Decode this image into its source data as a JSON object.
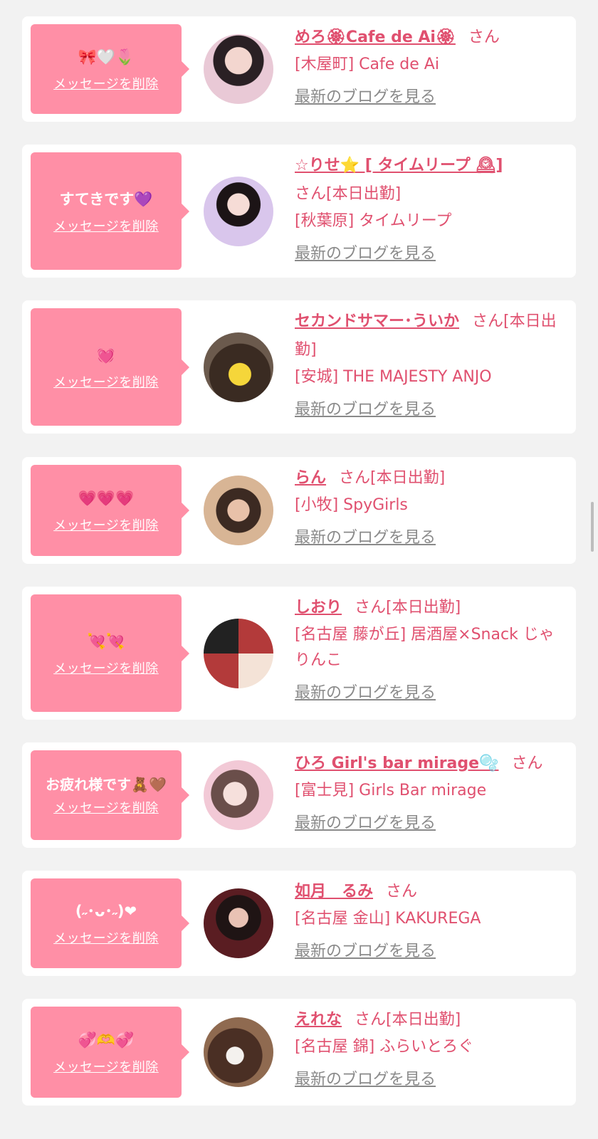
{
  "delete_label": "メッセージを削除",
  "blog_label": "最新のブログを見る",
  "colors": {
    "accent": "#ff8fa6",
    "name": "#e0506f",
    "link_gray": "#8a8a8a",
    "bg": "#f2f2f2"
  },
  "items": [
    {
      "message": "🎀🤍🌷",
      "name": "めろ🏵Cafe de Ai🏵",
      "suffix": "さん",
      "shop": "[木屋町] Cafe de Ai"
    },
    {
      "message": "すてきです💜",
      "name": "☆りせ⭐ [ タイムリープ 🕰]",
      "suffix": "さん[本日出勤]",
      "shop": "[秋葉原] タイムリープ"
    },
    {
      "message": "💓",
      "name": "セカンドサマー･ういか",
      "suffix": "さん[本日出勤]",
      "shop": "[安城] THE MAJESTY ANJO"
    },
    {
      "message": "💗💗💗",
      "name": "らん",
      "suffix": "さん[本日出勤]",
      "shop": "[小牧] SpyGirls"
    },
    {
      "message": "💘💘",
      "name": "しおり",
      "suffix": "さん[本日出勤]",
      "shop": "[名古屋 藤が丘] 居酒屋×Snack じゃりんこ"
    },
    {
      "message": "お疲れ様です🧸🤎",
      "name": "ひろ Girl's bar mirage🫧",
      "suffix": "さん",
      "shop": "[富士見] Girls Bar mirage"
    },
    {
      "message": "(˶･ᴗ･˶)❤",
      "name": "如月　るみ",
      "suffix": "さん",
      "shop": "[名古屋 金山] KAKUREGA"
    },
    {
      "message": "💞🫶💞",
      "name": "えれな",
      "suffix": "さん[本日出勤]",
      "shop": "[名古屋 錦] ふらいとろぐ"
    }
  ]
}
